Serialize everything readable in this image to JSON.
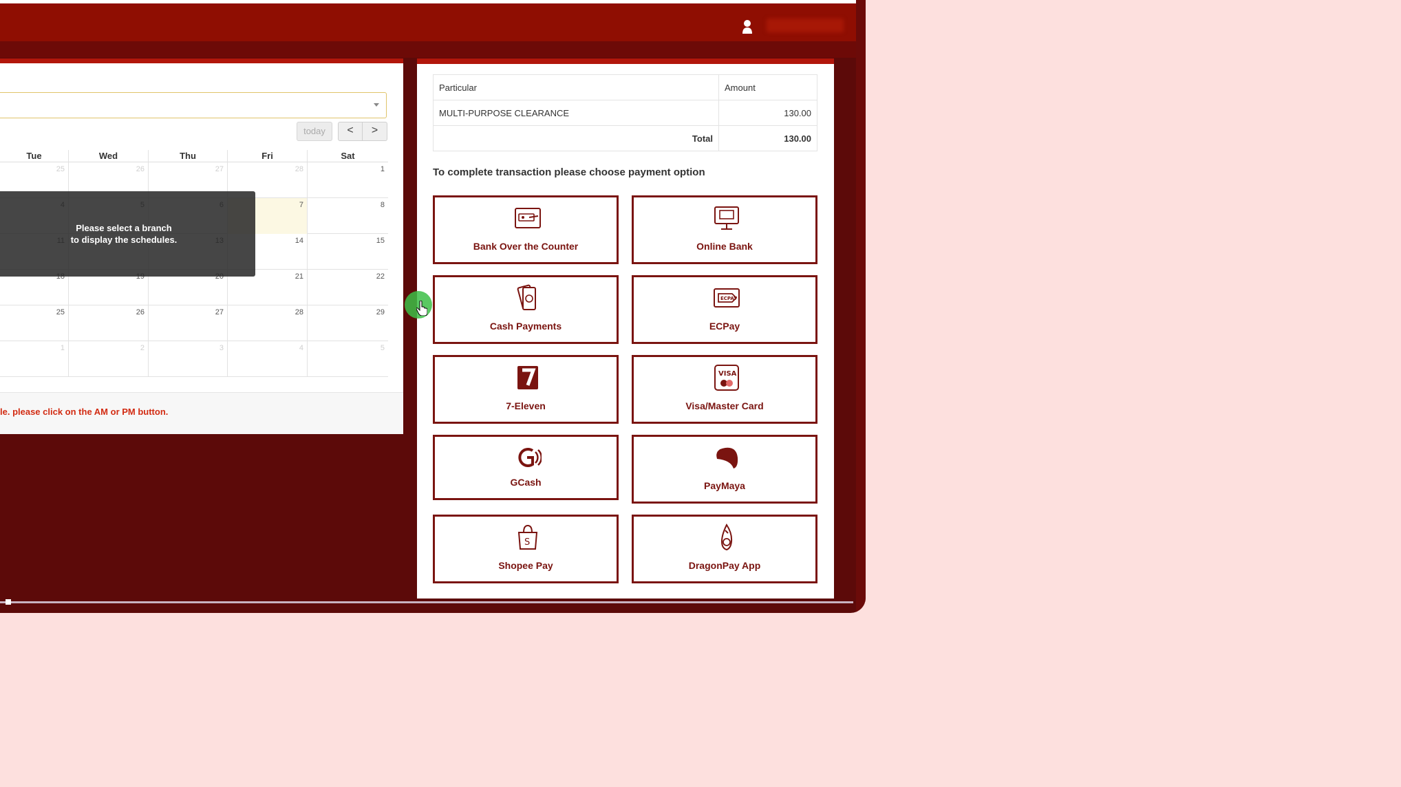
{
  "calendar": {
    "today_label": "today",
    "prev_label": "<",
    "next_label": ">",
    "day_headers": [
      "Tue",
      "Wed",
      "Thu",
      "Fri",
      "Sat"
    ],
    "weeks": [
      [
        "25",
        "26",
        "27",
        "28",
        "1"
      ],
      [
        "4",
        "5",
        "6",
        "7",
        "8"
      ],
      [
        "11",
        "12",
        "13",
        "14",
        "15"
      ],
      [
        "18",
        "19",
        "20",
        "21",
        "22"
      ],
      [
        "25",
        "26",
        "27",
        "28",
        "29"
      ],
      [
        "1",
        "2",
        "3",
        "4",
        "5"
      ]
    ],
    "overlay_line1": "Please select a branch",
    "overlay_line2": "to display the schedules.",
    "note": "le. please click on the AM or PM button."
  },
  "fees": {
    "col_particular": "Particular",
    "col_amount": "Amount",
    "rows": [
      {
        "particular": "MULTI-PURPOSE CLEARANCE",
        "amount": "130.00"
      }
    ],
    "total_label": "Total",
    "total_amount": "130.00"
  },
  "payment": {
    "instruction": "To complete transaction please choose payment option",
    "options": [
      {
        "label": "Bank Over the Counter",
        "icon": "bank-counter-icon"
      },
      {
        "label": "Online Bank",
        "icon": "online-bank-icon"
      },
      {
        "label": "Cash Payments",
        "icon": "cash-icon"
      },
      {
        "label": "ECPay",
        "icon": "ecpay-icon"
      },
      {
        "label": "7-Eleven",
        "icon": "seven-eleven-icon"
      },
      {
        "label": "Visa/Master Card",
        "icon": "visa-card-icon"
      },
      {
        "label": "GCash",
        "icon": "gcash-icon"
      },
      {
        "label": "PayMaya",
        "icon": "paymaya-icon"
      },
      {
        "label": "Shopee Pay",
        "icon": "shopee-pay-icon"
      },
      {
        "label": "DragonPay App",
        "icon": "dragonpay-icon"
      }
    ]
  },
  "colors": {
    "header": "#8f0e02",
    "accent_border": "#7a1410",
    "background": "#fde0de"
  }
}
